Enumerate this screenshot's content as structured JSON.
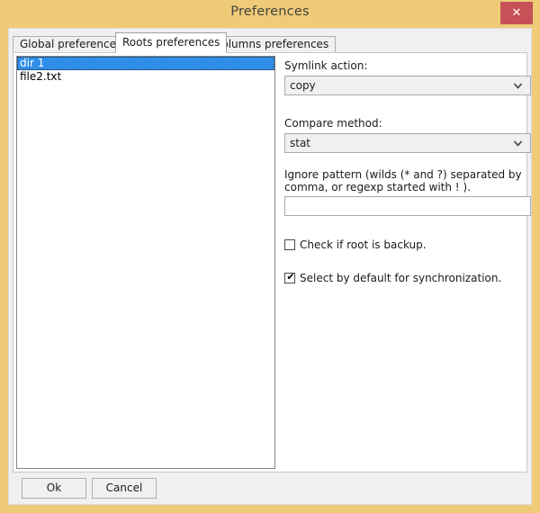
{
  "window": {
    "title": "Preferences",
    "close_label": "✕",
    "frame_color": "#efcb78",
    "close_button_color": "#c75156"
  },
  "tabs": [
    {
      "label": "Global preferences",
      "active": false
    },
    {
      "label": "Roots preferences",
      "active": true
    },
    {
      "label": "Columns preferences",
      "active": false
    }
  ],
  "roots_list": {
    "items": [
      {
        "label": "dir 1",
        "selected": true
      },
      {
        "label": "file2.txt",
        "selected": false
      }
    ],
    "selection_color": "#2f8fe8"
  },
  "options": {
    "symlink": {
      "label": "Symlink action:",
      "value": "copy"
    },
    "compare": {
      "label": "Compare method:",
      "value": "stat"
    },
    "ignore_pattern": {
      "label": "Ignore pattern (wilds (* and ?) separated by comma, or regexp started with ! ).",
      "value": "",
      "placeholder": ""
    },
    "check_backup": {
      "label": "Check if root is backup.",
      "checked": false,
      "glyph": "✔"
    },
    "select_default": {
      "label": "Select by default for synchronization.",
      "checked": true,
      "glyph": "✔"
    }
  },
  "footer": {
    "ok_label": "Ok",
    "cancel_label": "Cancel"
  },
  "icons": {
    "chevron_down": "❯"
  }
}
